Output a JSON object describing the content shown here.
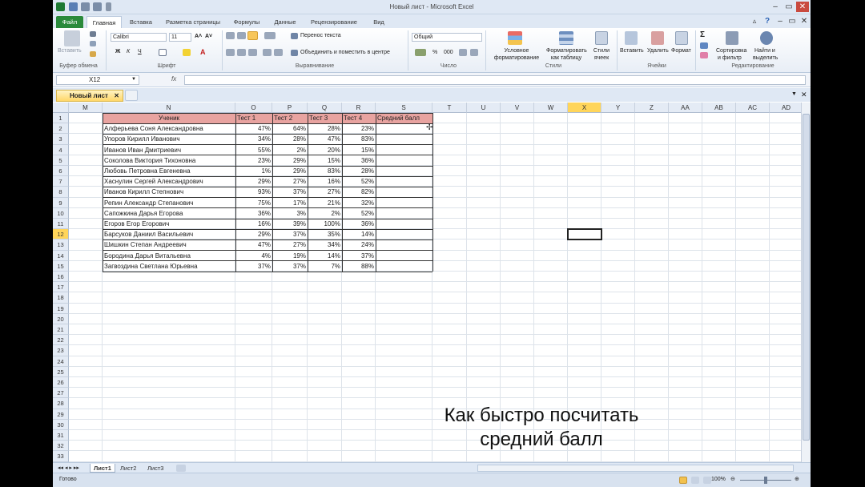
{
  "window": {
    "title": "Новый лист - Microsoft Excel"
  },
  "tabs": [
    "Файл",
    "Главная",
    "Вставка",
    "Разметка страницы",
    "Формулы",
    "Данные",
    "Рецензирование",
    "Вид"
  ],
  "ribbon": {
    "paste": "Вставить",
    "clipboard": "Буфер обмена",
    "font_name": "Calibri",
    "font_size": "11",
    "bold": "Ж",
    "italic": "К",
    "underline": "Ч",
    "font_group": "Шрифт",
    "wrap_text": "Перенос текста",
    "merge_center": "Объединить и поместить в центре",
    "alignment_group": "Выравнивание",
    "number_format": "Общий",
    "percent": "%",
    "thousands": "000",
    "number_group": "Число",
    "conditional_1": "Условное",
    "conditional_2": "форматирование",
    "format_table_1": "Форматировать",
    "format_table_2": "как таблицу",
    "cell_styles_1": "Стили",
    "cell_styles_2": "ячеек",
    "styles_group": "Стили",
    "insert": "Вставить",
    "delete": "Удалить",
    "format": "Формат",
    "cells_group": "Ячейки",
    "sort_1": "Сортировка",
    "sort_2": "и фильтр",
    "find_1": "Найти и",
    "find_2": "выделить",
    "editing_group": "Редактирование"
  },
  "formula_bar": {
    "name_box": "X12",
    "fx": "fx",
    "formula": ""
  },
  "workbook_tab": "Новый лист",
  "columns": [
    "M",
    "N",
    "O",
    "P",
    "Q",
    "R",
    "S",
    "T",
    "U",
    "V",
    "W",
    "X",
    "Y",
    "Z",
    "AA",
    "AB",
    "AC",
    "AD"
  ],
  "selected_col": "X",
  "selected_row": 12,
  "table": {
    "headers": [
      "Ученик",
      "Тест 1",
      "Тест 2",
      "Тест 3",
      "Тест 4",
      "Средний балл"
    ],
    "rows": [
      [
        "Алферьева Соня Александровна",
        "47%",
        "64%",
        "28%",
        "23%"
      ],
      [
        "Упоров Кирилл Иванович",
        "34%",
        "28%",
        "47%",
        "83%"
      ],
      [
        "Иванов Иван Дмитриевич",
        "55%",
        "2%",
        "20%",
        "15%"
      ],
      [
        "Соколова Виктория Тихоновна",
        "23%",
        "29%",
        "15%",
        "36%"
      ],
      [
        "Любовь Петровна Евгеневна",
        "1%",
        "29%",
        "83%",
        "28%"
      ],
      [
        "Хаснулин Сергей Александрович",
        "29%",
        "27%",
        "16%",
        "52%"
      ],
      [
        "Иванов Кирилл Степнович",
        "93%",
        "37%",
        "27%",
        "82%"
      ],
      [
        "Репин Александр Степанович",
        "75%",
        "17%",
        "21%",
        "32%"
      ],
      [
        "Сапожкина Дарья Егорова",
        "36%",
        "3%",
        "2%",
        "52%"
      ],
      [
        "Егоров Егор Егорович",
        "16%",
        "39%",
        "100%",
        "36%"
      ],
      [
        "Барсуков Даниил Васильевич",
        "29%",
        "37%",
        "35%",
        "14%"
      ],
      [
        "Шишкин Степан Андреевич",
        "47%",
        "27%",
        "34%",
        "24%"
      ],
      [
        "Бородина Дарья Витальевна",
        "4%",
        "19%",
        "14%",
        "37%"
      ],
      [
        "Загвоздина Светлана Юрьевна",
        "37%",
        "37%",
        "7%",
        "88%"
      ]
    ]
  },
  "overlay_text": [
    "Как быстро посчитать",
    "средний балл"
  ],
  "sheets": [
    "Лист1",
    "Лист2",
    "Лист3"
  ],
  "status": {
    "ready": "Готово",
    "zoom": "100%"
  }
}
